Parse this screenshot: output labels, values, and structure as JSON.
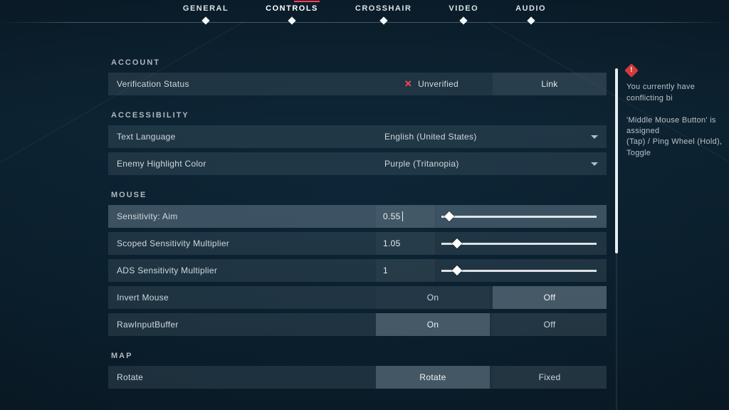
{
  "tabs": {
    "items": [
      "GENERAL",
      "CONTROLS",
      "CROSSHAIR",
      "VIDEO",
      "AUDIO"
    ],
    "active_index": 1
  },
  "warning": {
    "line1": "You currently have conflicting bi",
    "line2": "'Middle Mouse Button' is assigned",
    "line3": "(Tap) / Ping Wheel (Hold), Toggle"
  },
  "sections": {
    "account": {
      "title": "ACCOUNT",
      "verification": {
        "label": "Verification Status",
        "status": "Unverified",
        "link_label": "Link"
      }
    },
    "accessibility": {
      "title": "ACCESSIBILITY",
      "language": {
        "label": "Text Language",
        "value": "English (United States)"
      },
      "highlight": {
        "label": "Enemy Highlight Color",
        "value": "Purple (Tritanopia)"
      }
    },
    "mouse": {
      "title": "MOUSE",
      "sens_aim": {
        "label": "Sensitivity: Aim",
        "value": "0.55",
        "pct": 5
      },
      "scoped": {
        "label": "Scoped Sensitivity Multiplier",
        "value": "1.05",
        "pct": 10
      },
      "ads": {
        "label": "ADS Sensitivity Multiplier",
        "value": "1",
        "pct": 10
      },
      "invert": {
        "label": "Invert Mouse",
        "options": [
          "On",
          "Off"
        ],
        "selected_index": 1
      },
      "rawbuf": {
        "label": "RawInputBuffer",
        "options": [
          "On",
          "Off"
        ],
        "selected_index": 0
      }
    },
    "map": {
      "title": "MAP",
      "rotate": {
        "label": "Rotate",
        "options": [
          "Rotate",
          "Fixed"
        ],
        "selected_index": 0
      }
    }
  }
}
